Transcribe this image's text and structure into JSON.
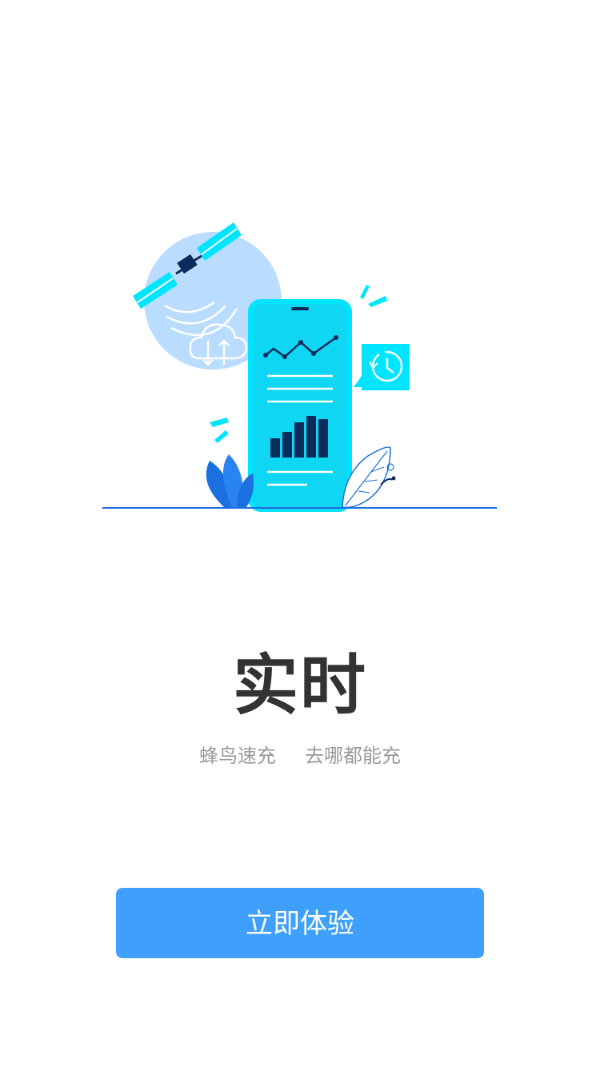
{
  "onboarding": {
    "headline": "实时",
    "tagline_left": "蜂鸟速充",
    "tagline_right": "去哪都能充",
    "cta_label": "立即体验"
  },
  "illustration": {
    "icons": [
      "satellite-icon",
      "cloud-sync-icon",
      "phone-chart-icon",
      "clock-message-icon",
      "leaf-icon"
    ]
  },
  "colors": {
    "accent": "#3fa0fb",
    "cyan": "#00e5ff",
    "navy": "#0d2b5a",
    "light_blue": "#b9dcff",
    "headline": "#333333",
    "tagline": "#9a9a9a"
  }
}
